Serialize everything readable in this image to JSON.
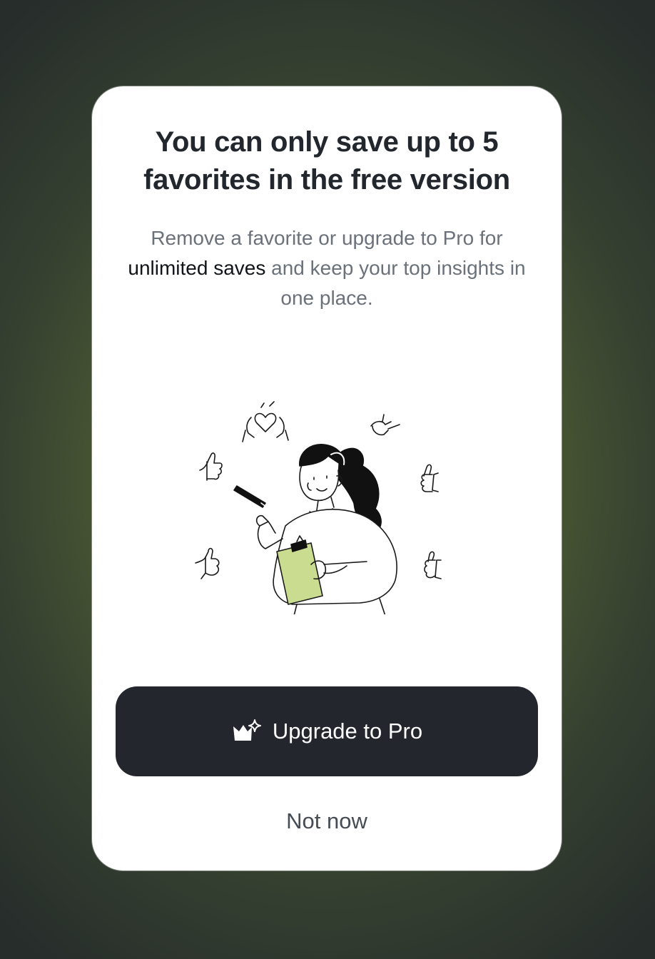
{
  "dialog": {
    "title": "You can only save up to 5 favorites in the free version",
    "subtitle": {
      "part1": "Remove a favorite or upgrade to Pro for ",
      "highlight": "unlimited saves",
      "part2": " and keep your top insights in one place."
    },
    "illustration_icon": "woman-with-clipboard-thumbs-up-illustration",
    "primary_button": {
      "label": "Upgrade to Pro",
      "icon": "crown-sparkle-icon"
    },
    "secondary_button": {
      "label": "Not now"
    }
  },
  "colors": {
    "backdrop": "#4d5c33",
    "card": "#ffffff",
    "title": "#22272d",
    "subtitle": "#6a717a",
    "highlight": "#111419",
    "primary_button_bg": "#23272d",
    "accent_green": "#c9dc8f"
  }
}
